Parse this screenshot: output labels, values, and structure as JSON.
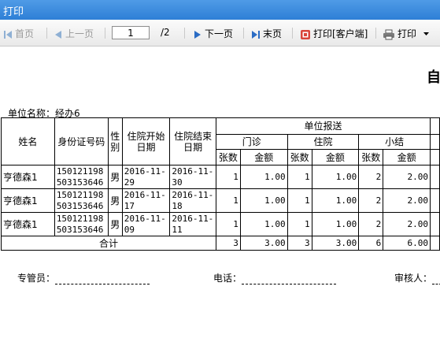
{
  "window": {
    "title": "打印"
  },
  "toolbar": {
    "first": "首页",
    "prev": "上一页",
    "page_value": "1",
    "page_total": "/2",
    "next": "下一页",
    "last": "末页",
    "print_client": "打印[客户端]",
    "print": "打印"
  },
  "report": {
    "title": "自",
    "unit_label": "单位名称：",
    "unit_value": "经办6",
    "headers": {
      "name": "姓名",
      "id": "身份证号码",
      "sex": "性别",
      "start": "住院开始日期",
      "end": "住院结束日期",
      "group": "单位报送",
      "outpatient": "门诊",
      "inpatient": "住院",
      "subtotal": "小结",
      "count": "张数",
      "amount": "金额"
    },
    "rows": [
      {
        "name": "亨德森1",
        "id": "150121198503153646",
        "sex": "男",
        "start": "2016-11-29",
        "end": "2016-11-30",
        "op_count": "1",
        "op_amount": "1.00",
        "ip_count": "1",
        "ip_amount": "1.00",
        "sub_count": "2",
        "sub_amount": "2.00"
      },
      {
        "name": "亨德森1",
        "id": "150121198503153646",
        "sex": "男",
        "start": "2016-11-17",
        "end": "2016-11-18",
        "op_count": "1",
        "op_amount": "1.00",
        "ip_count": "1",
        "ip_amount": "1.00",
        "sub_count": "2",
        "sub_amount": "2.00"
      },
      {
        "name": "亨德森1",
        "id": "150121198503153646",
        "sex": "男",
        "start": "2016-11-09",
        "end": "2016-11-11",
        "op_count": "1",
        "op_amount": "1.00",
        "ip_count": "1",
        "ip_amount": "1.00",
        "sub_count": "2",
        "sub_amount": "2.00"
      }
    ],
    "total": {
      "label": "合计",
      "op_count": "3",
      "op_amount": "3.00",
      "ip_count": "3",
      "ip_amount": "3.00",
      "sub_count": "6",
      "sub_amount": "6.00"
    },
    "signatures": {
      "manager": "专管员：",
      "phone": "电话：",
      "reviewer": "审核人："
    }
  }
}
